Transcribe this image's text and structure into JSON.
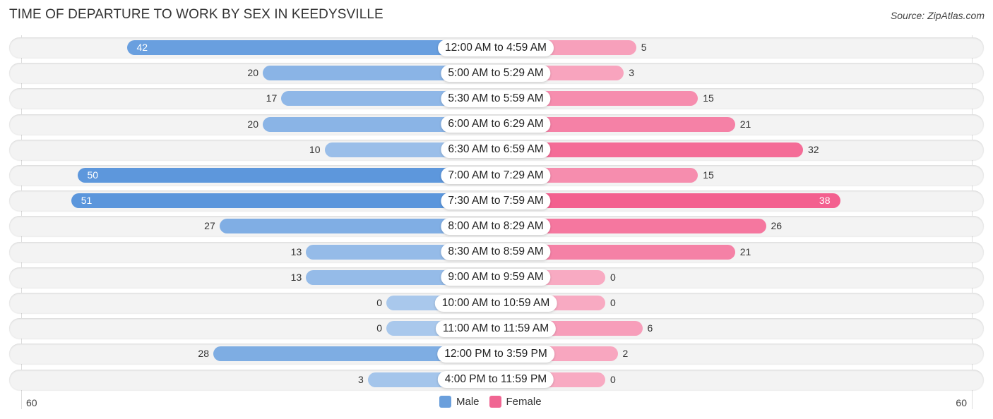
{
  "chart_data": {
    "type": "bar",
    "orientation": "horizontal-diverging",
    "title": "TIME OF DEPARTURE TO WORK BY SEX IN KEEDYSVILLE",
    "source": "Source: ZipAtlas.com",
    "categories": [
      "12:00 AM to 4:59 AM",
      "5:00 AM to 5:29 AM",
      "5:30 AM to 5:59 AM",
      "6:00 AM to 6:29 AM",
      "6:30 AM to 6:59 AM",
      "7:00 AM to 7:29 AM",
      "7:30 AM to 7:59 AM",
      "8:00 AM to 8:29 AM",
      "8:30 AM to 8:59 AM",
      "9:00 AM to 9:59 AM",
      "10:00 AM to 10:59 AM",
      "11:00 AM to 11:59 AM",
      "12:00 PM to 3:59 PM",
      "4:00 PM to 11:59 PM"
    ],
    "series": [
      {
        "name": "Male",
        "color": "#6a9fdc",
        "values": [
          42,
          20,
          17,
          20,
          10,
          50,
          51,
          27,
          13,
          13,
          0,
          0,
          28,
          3
        ]
      },
      {
        "name": "Female",
        "color": "#f06592",
        "values": [
          5,
          3,
          15,
          21,
          32,
          15,
          38,
          26,
          21,
          0,
          0,
          6,
          2,
          0
        ]
      }
    ],
    "axis": {
      "left_label": "60",
      "right_label": "60",
      "range": [
        -60,
        60
      ]
    },
    "legend": {
      "position": "bottom-center",
      "items": [
        "Male",
        "Female"
      ]
    }
  }
}
